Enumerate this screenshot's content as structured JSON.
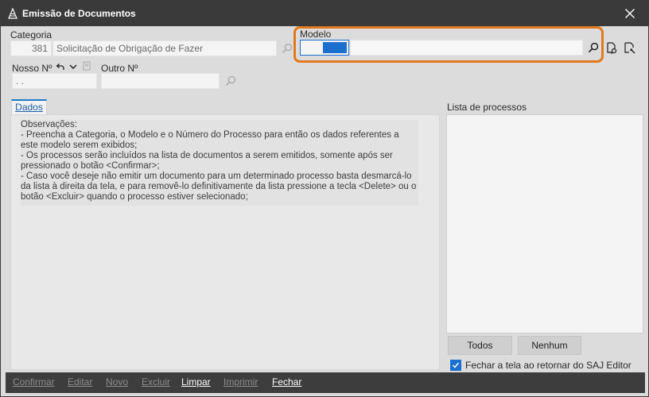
{
  "window": {
    "title": "Emissão de Documentos"
  },
  "categoria": {
    "label": "Categoria",
    "code": "381",
    "name": "Solicitação de Obrigação de Fazer"
  },
  "modelo": {
    "label": "Modelo",
    "value": ""
  },
  "nosso_no": {
    "label": "Nosso Nº",
    "value": ". ."
  },
  "outro_no": {
    "label": "Outro Nº",
    "value": ""
  },
  "tabs": [
    {
      "label": "Dados"
    }
  ],
  "observacoes": "Observações:\n  - Preencha a Categoria, o Modelo e o Número do Processo para então os dados referentes a este modelo serem exibidos;\n  - Os processos serão incluídos na lista de documentos a serem emitidos, somente após ser pressionado o botão <Confirmar>;\n  - Caso você deseje não emitir um documento para um determinado processo basta desmarcá-lo da lista à direita da tela, e para removê-lo definitivamente da lista pressione a tecla <Delete> ou o botão <Excluir> quando o processo estiver selecionado;",
  "lista": {
    "label": "Lista de processos",
    "todos": "Todos",
    "nenhum": "Nenhum"
  },
  "fechar_check": {
    "label": "Fechar a tela ao retornar do SAJ Editor",
    "checked": true
  },
  "footer": {
    "confirmar": "Confirmar",
    "editar": "Editar",
    "novo": "Novo",
    "excluir": "Excluir",
    "limpar": "Limpar",
    "imprimir": "Imprimir",
    "fechar": "Fechar"
  },
  "colors": {
    "accent": "#1b6fcf",
    "highlight": "#e07a1c",
    "titlebar": "#3a3a3a"
  }
}
